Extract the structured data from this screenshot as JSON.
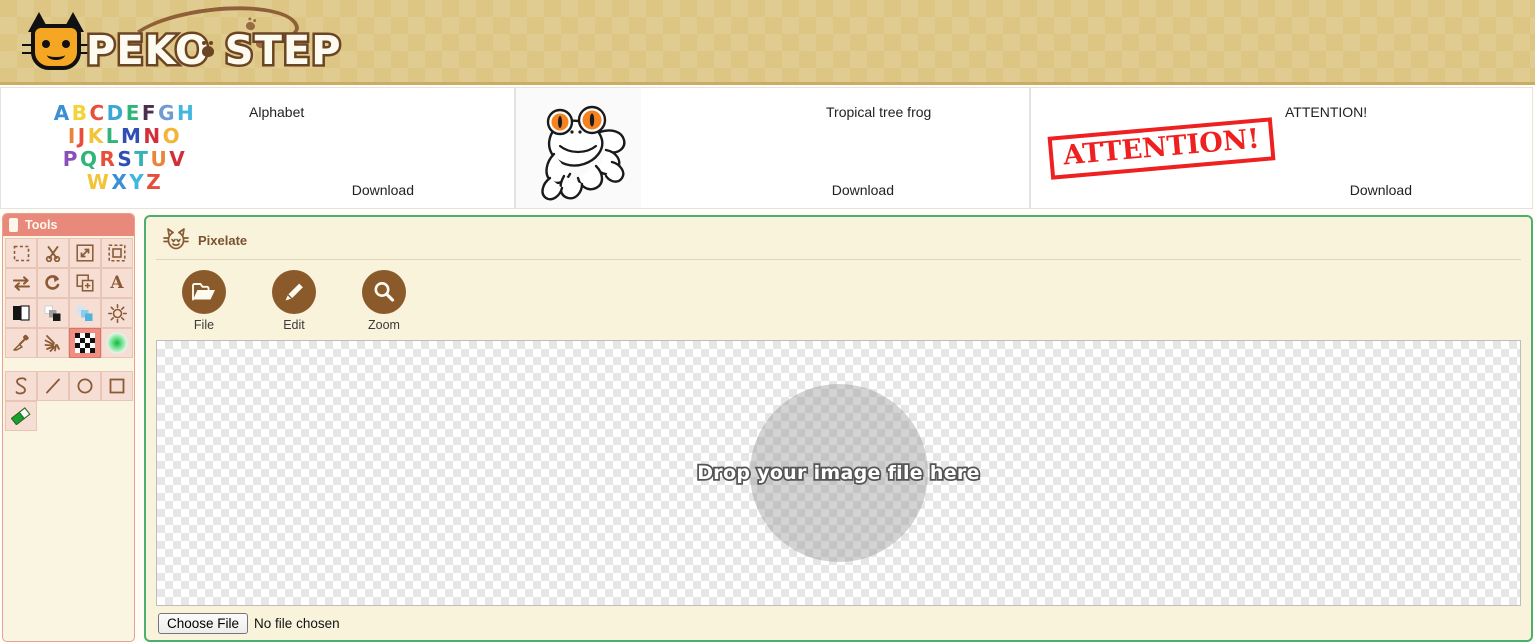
{
  "site": {
    "logo_text": "PEKO STEP",
    "logo_icon": "cat-head-icon"
  },
  "thumbnails": [
    {
      "title": "Alphabet",
      "download_label": "Download",
      "art": "alphabet-letters",
      "alphabet_rows": [
        "ABCDEFGH",
        "IJKLMNO",
        "PQRSTUV",
        "WXYZ"
      ]
    },
    {
      "title": "Tropical tree frog",
      "download_label": "Download",
      "art": "tree-frog-illustration"
    },
    {
      "title": "ATTENTION!",
      "download_label": "Download",
      "art": "attention-stamp",
      "stamp_text": "ATTENTION!"
    }
  ],
  "tools_panel": {
    "header_title": "Tools",
    "selected_tool": "checkerboard-transparency-tool",
    "rows": [
      [
        {
          "name": "rectangular-select-tool",
          "label": "Rectangular select"
        },
        {
          "name": "scissors-cut-tool",
          "label": "Cut"
        },
        {
          "name": "resize-tool",
          "label": "Resize"
        },
        {
          "name": "crop-tool",
          "label": "Crop"
        }
      ],
      [
        {
          "name": "flip-tool",
          "label": "Flip"
        },
        {
          "name": "rotate-tool",
          "label": "Rotate"
        },
        {
          "name": "add-layer-tool",
          "label": "Add layer"
        },
        {
          "name": "text-tool",
          "label": "Text"
        }
      ],
      [
        {
          "name": "contrast-tool",
          "label": "Contrast"
        },
        {
          "name": "grayscale-tool",
          "label": "Grayscale"
        },
        {
          "name": "colorize-tool",
          "label": "Colorize"
        },
        {
          "name": "brightness-tool",
          "label": "Brightness"
        }
      ],
      [
        {
          "name": "eyedropper-tool",
          "label": "Color picker"
        },
        {
          "name": "blur-tool",
          "label": "Blur"
        },
        {
          "name": "checkerboard-transparency-tool",
          "label": "Transparency"
        },
        {
          "name": "gradient-tool",
          "label": "Gradient"
        }
      ]
    ],
    "shape_rows": [
      [
        {
          "name": "curve-tool",
          "label": "Curve"
        },
        {
          "name": "line-tool",
          "label": "Line"
        },
        {
          "name": "ellipse-tool",
          "label": "Ellipse"
        },
        {
          "name": "rectangle-tool",
          "label": "Rectangle"
        }
      ],
      [
        {
          "name": "eraser-tool",
          "label": "Eraser"
        }
      ]
    ]
  },
  "editor": {
    "app_title": "Pixelate",
    "app_icon": "cat-head-icon",
    "menu": [
      {
        "name": "file-menu-button",
        "label": "File",
        "icon": "folder-icon"
      },
      {
        "name": "edit-menu-button",
        "label": "Edit",
        "icon": "pencil-icon"
      },
      {
        "name": "zoom-menu-button",
        "label": "Zoom",
        "icon": "magnifier-icon"
      }
    ],
    "canvas": {
      "drop_text": "Drop your image file here"
    },
    "file_input": {
      "button_label": "Choose File",
      "status_text": "No file chosen"
    }
  },
  "colors": {
    "header_bg": "#ddc584",
    "panel_border_green": "#4caf70",
    "panel_bg": "#faf3dc",
    "tools_header": "#e8897c",
    "tool_cell": "#f6ded4",
    "tool_selected": "#f08e82",
    "icon_brown": "#8a5a34",
    "menu_circle": "#8b5a2b",
    "stamp_red": "#ee2020"
  },
  "alphabet_colors": [
    [
      "#3a8fd6",
      "#f2d43a",
      "#e84f3a",
      "#3aa7d6",
      "#2fb57a",
      "#4b2f4e",
      "#6f9bd1",
      "#3fb7e0"
    ],
    [
      "#e8853a",
      "#e84f3a",
      "#f2c43a",
      "#2fb57a",
      "#2f4fb5",
      "#d12f3a",
      "#f2b53a"
    ],
    [
      "#8a4fb5",
      "#2fb57a",
      "#e84f3a",
      "#2f4fb5",
      "#2fb5b5",
      "#e8853a",
      "#d12f3a"
    ],
    [
      "#f2c43a",
      "#3a8fd6",
      "#3fb7e0",
      "#e84f3a"
    ]
  ]
}
